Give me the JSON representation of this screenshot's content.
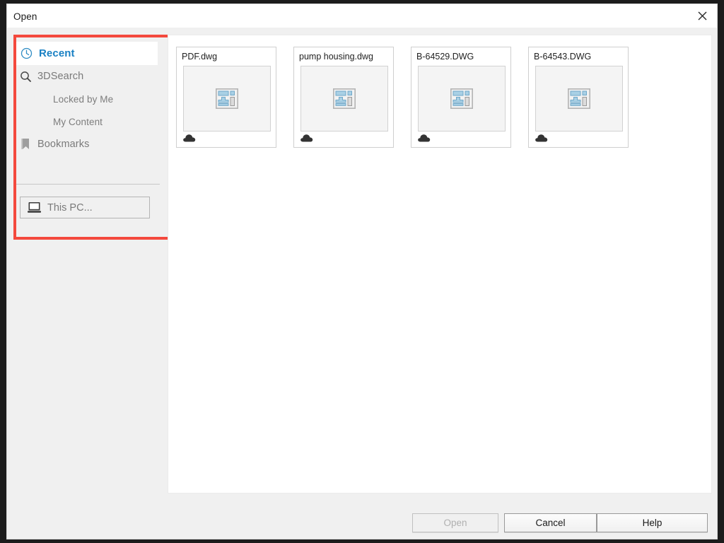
{
  "window": {
    "title": "Open",
    "close_icon": "close-icon"
  },
  "sidebar": {
    "items": [
      {
        "label": "Recent",
        "icon": "clock-icon",
        "selected": true,
        "level": 1
      },
      {
        "label": "3DSearch",
        "icon": "search-icon",
        "selected": false,
        "level": 1
      },
      {
        "label": "Locked by Me",
        "icon": "",
        "selected": false,
        "level": 2
      },
      {
        "label": "My Content",
        "icon": "",
        "selected": false,
        "level": 2
      },
      {
        "label": "Bookmarks",
        "icon": "bookmark-icon",
        "selected": false,
        "level": 1
      }
    ],
    "this_pc": {
      "label": "This PC...",
      "icon": "computer-icon"
    },
    "highlight_color": "#f4493d",
    "selected_color": "#1a81c4"
  },
  "files": [
    {
      "name": "PDF.dwg",
      "thumb_icon": "drawing-icon",
      "badge": "cloud-icon"
    },
    {
      "name": "pump housing.dwg",
      "thumb_icon": "drawing-icon",
      "badge": "cloud-icon"
    },
    {
      "name": "B-64529.DWG",
      "thumb_icon": "drawing-icon",
      "badge": "cloud-icon"
    },
    {
      "name": "B-64543.DWG",
      "thumb_icon": "drawing-icon",
      "badge": "cloud-icon"
    }
  ],
  "footer": {
    "open_label": "Open",
    "open_enabled": false,
    "cancel_label": "Cancel",
    "help_label": "Help"
  }
}
